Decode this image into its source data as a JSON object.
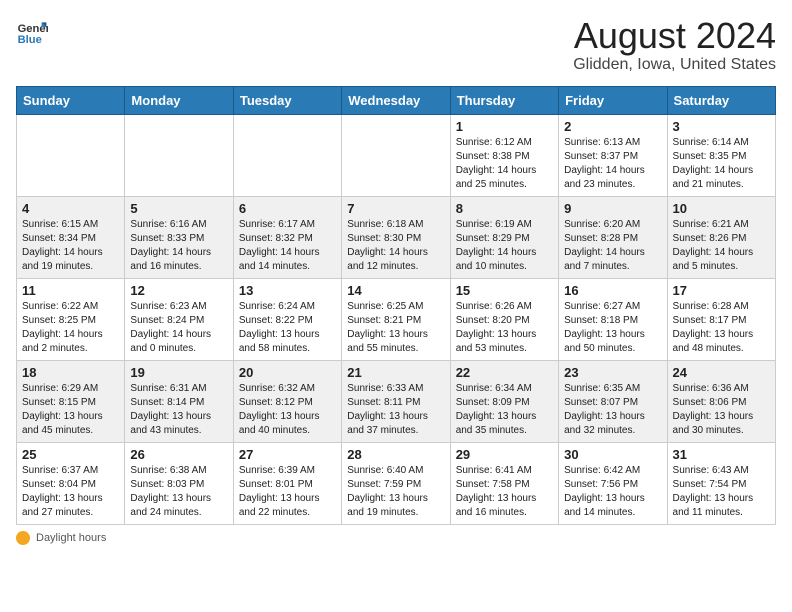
{
  "header": {
    "logo_line1": "General",
    "logo_line2": "Blue",
    "main_title": "August 2024",
    "subtitle": "Glidden, Iowa, United States"
  },
  "weekdays": [
    "Sunday",
    "Monday",
    "Tuesday",
    "Wednesday",
    "Thursday",
    "Friday",
    "Saturday"
  ],
  "weeks": [
    [
      {
        "day": "",
        "info": ""
      },
      {
        "day": "",
        "info": ""
      },
      {
        "day": "",
        "info": ""
      },
      {
        "day": "",
        "info": ""
      },
      {
        "day": "1",
        "info": "Sunrise: 6:12 AM\nSunset: 8:38 PM\nDaylight: 14 hours\nand 25 minutes."
      },
      {
        "day": "2",
        "info": "Sunrise: 6:13 AM\nSunset: 8:37 PM\nDaylight: 14 hours\nand 23 minutes."
      },
      {
        "day": "3",
        "info": "Sunrise: 6:14 AM\nSunset: 8:35 PM\nDaylight: 14 hours\nand 21 minutes."
      }
    ],
    [
      {
        "day": "4",
        "info": "Sunrise: 6:15 AM\nSunset: 8:34 PM\nDaylight: 14 hours\nand 19 minutes."
      },
      {
        "day": "5",
        "info": "Sunrise: 6:16 AM\nSunset: 8:33 PM\nDaylight: 14 hours\nand 16 minutes."
      },
      {
        "day": "6",
        "info": "Sunrise: 6:17 AM\nSunset: 8:32 PM\nDaylight: 14 hours\nand 14 minutes."
      },
      {
        "day": "7",
        "info": "Sunrise: 6:18 AM\nSunset: 8:30 PM\nDaylight: 14 hours\nand 12 minutes."
      },
      {
        "day": "8",
        "info": "Sunrise: 6:19 AM\nSunset: 8:29 PM\nDaylight: 14 hours\nand 10 minutes."
      },
      {
        "day": "9",
        "info": "Sunrise: 6:20 AM\nSunset: 8:28 PM\nDaylight: 14 hours\nand 7 minutes."
      },
      {
        "day": "10",
        "info": "Sunrise: 6:21 AM\nSunset: 8:26 PM\nDaylight: 14 hours\nand 5 minutes."
      }
    ],
    [
      {
        "day": "11",
        "info": "Sunrise: 6:22 AM\nSunset: 8:25 PM\nDaylight: 14 hours\nand 2 minutes."
      },
      {
        "day": "12",
        "info": "Sunrise: 6:23 AM\nSunset: 8:24 PM\nDaylight: 14 hours\nand 0 minutes."
      },
      {
        "day": "13",
        "info": "Sunrise: 6:24 AM\nSunset: 8:22 PM\nDaylight: 13 hours\nand 58 minutes."
      },
      {
        "day": "14",
        "info": "Sunrise: 6:25 AM\nSunset: 8:21 PM\nDaylight: 13 hours\nand 55 minutes."
      },
      {
        "day": "15",
        "info": "Sunrise: 6:26 AM\nSunset: 8:20 PM\nDaylight: 13 hours\nand 53 minutes."
      },
      {
        "day": "16",
        "info": "Sunrise: 6:27 AM\nSunset: 8:18 PM\nDaylight: 13 hours\nand 50 minutes."
      },
      {
        "day": "17",
        "info": "Sunrise: 6:28 AM\nSunset: 8:17 PM\nDaylight: 13 hours\nand 48 minutes."
      }
    ],
    [
      {
        "day": "18",
        "info": "Sunrise: 6:29 AM\nSunset: 8:15 PM\nDaylight: 13 hours\nand 45 minutes."
      },
      {
        "day": "19",
        "info": "Sunrise: 6:31 AM\nSunset: 8:14 PM\nDaylight: 13 hours\nand 43 minutes."
      },
      {
        "day": "20",
        "info": "Sunrise: 6:32 AM\nSunset: 8:12 PM\nDaylight: 13 hours\nand 40 minutes."
      },
      {
        "day": "21",
        "info": "Sunrise: 6:33 AM\nSunset: 8:11 PM\nDaylight: 13 hours\nand 37 minutes."
      },
      {
        "day": "22",
        "info": "Sunrise: 6:34 AM\nSunset: 8:09 PM\nDaylight: 13 hours\nand 35 minutes."
      },
      {
        "day": "23",
        "info": "Sunrise: 6:35 AM\nSunset: 8:07 PM\nDaylight: 13 hours\nand 32 minutes."
      },
      {
        "day": "24",
        "info": "Sunrise: 6:36 AM\nSunset: 8:06 PM\nDaylight: 13 hours\nand 30 minutes."
      }
    ],
    [
      {
        "day": "25",
        "info": "Sunrise: 6:37 AM\nSunset: 8:04 PM\nDaylight: 13 hours\nand 27 minutes."
      },
      {
        "day": "26",
        "info": "Sunrise: 6:38 AM\nSunset: 8:03 PM\nDaylight: 13 hours\nand 24 minutes."
      },
      {
        "day": "27",
        "info": "Sunrise: 6:39 AM\nSunset: 8:01 PM\nDaylight: 13 hours\nand 22 minutes."
      },
      {
        "day": "28",
        "info": "Sunrise: 6:40 AM\nSunset: 7:59 PM\nDaylight: 13 hours\nand 19 minutes."
      },
      {
        "day": "29",
        "info": "Sunrise: 6:41 AM\nSunset: 7:58 PM\nDaylight: 13 hours\nand 16 minutes."
      },
      {
        "day": "30",
        "info": "Sunrise: 6:42 AM\nSunset: 7:56 PM\nDaylight: 13 hours\nand 14 minutes."
      },
      {
        "day": "31",
        "info": "Sunrise: 6:43 AM\nSunset: 7:54 PM\nDaylight: 13 hours\nand 11 minutes."
      }
    ]
  ],
  "footer": {
    "daylight_label": "Daylight hours"
  }
}
